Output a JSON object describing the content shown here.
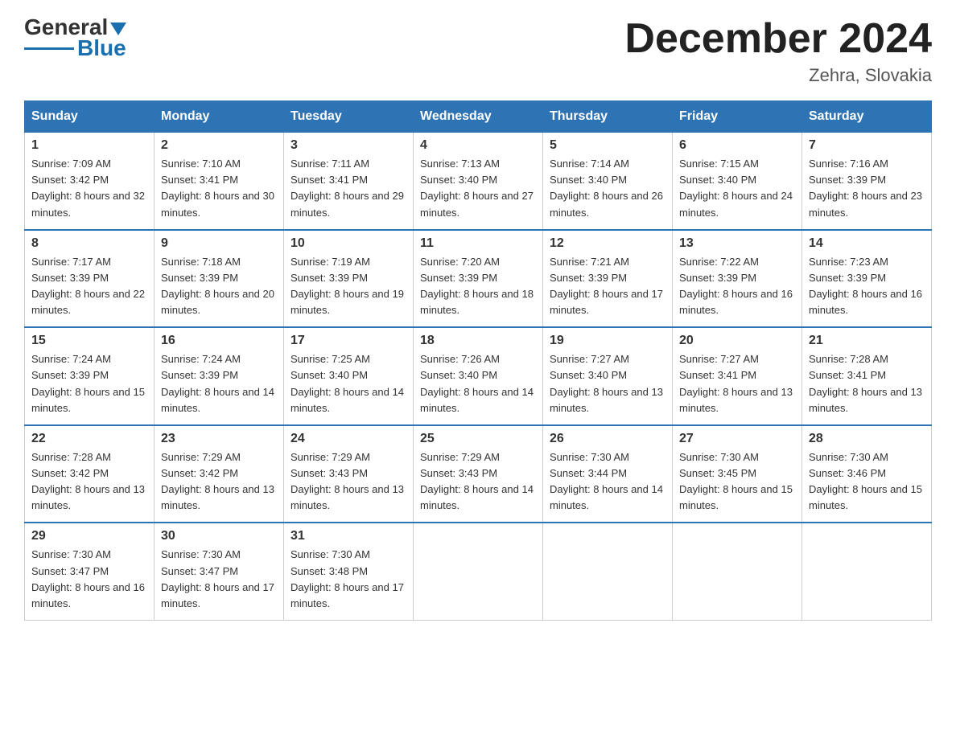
{
  "header": {
    "logo": {
      "general": "General",
      "blue": "Blue"
    },
    "title": "December 2024",
    "location": "Zehra, Slovakia"
  },
  "weekdays": [
    "Sunday",
    "Monday",
    "Tuesday",
    "Wednesday",
    "Thursday",
    "Friday",
    "Saturday"
  ],
  "weeks": [
    [
      {
        "day": "1",
        "sunrise": "7:09 AM",
        "sunset": "3:42 PM",
        "daylight": "8 hours and 32 minutes."
      },
      {
        "day": "2",
        "sunrise": "7:10 AM",
        "sunset": "3:41 PM",
        "daylight": "8 hours and 30 minutes."
      },
      {
        "day": "3",
        "sunrise": "7:11 AM",
        "sunset": "3:41 PM",
        "daylight": "8 hours and 29 minutes."
      },
      {
        "day": "4",
        "sunrise": "7:13 AM",
        "sunset": "3:40 PM",
        "daylight": "8 hours and 27 minutes."
      },
      {
        "day": "5",
        "sunrise": "7:14 AM",
        "sunset": "3:40 PM",
        "daylight": "8 hours and 26 minutes."
      },
      {
        "day": "6",
        "sunrise": "7:15 AM",
        "sunset": "3:40 PM",
        "daylight": "8 hours and 24 minutes."
      },
      {
        "day": "7",
        "sunrise": "7:16 AM",
        "sunset": "3:39 PM",
        "daylight": "8 hours and 23 minutes."
      }
    ],
    [
      {
        "day": "8",
        "sunrise": "7:17 AM",
        "sunset": "3:39 PM",
        "daylight": "8 hours and 22 minutes."
      },
      {
        "day": "9",
        "sunrise": "7:18 AM",
        "sunset": "3:39 PM",
        "daylight": "8 hours and 20 minutes."
      },
      {
        "day": "10",
        "sunrise": "7:19 AM",
        "sunset": "3:39 PM",
        "daylight": "8 hours and 19 minutes."
      },
      {
        "day": "11",
        "sunrise": "7:20 AM",
        "sunset": "3:39 PM",
        "daylight": "8 hours and 18 minutes."
      },
      {
        "day": "12",
        "sunrise": "7:21 AM",
        "sunset": "3:39 PM",
        "daylight": "8 hours and 17 minutes."
      },
      {
        "day": "13",
        "sunrise": "7:22 AM",
        "sunset": "3:39 PM",
        "daylight": "8 hours and 16 minutes."
      },
      {
        "day": "14",
        "sunrise": "7:23 AM",
        "sunset": "3:39 PM",
        "daylight": "8 hours and 16 minutes."
      }
    ],
    [
      {
        "day": "15",
        "sunrise": "7:24 AM",
        "sunset": "3:39 PM",
        "daylight": "8 hours and 15 minutes."
      },
      {
        "day": "16",
        "sunrise": "7:24 AM",
        "sunset": "3:39 PM",
        "daylight": "8 hours and 14 minutes."
      },
      {
        "day": "17",
        "sunrise": "7:25 AM",
        "sunset": "3:40 PM",
        "daylight": "8 hours and 14 minutes."
      },
      {
        "day": "18",
        "sunrise": "7:26 AM",
        "sunset": "3:40 PM",
        "daylight": "8 hours and 14 minutes."
      },
      {
        "day": "19",
        "sunrise": "7:27 AM",
        "sunset": "3:40 PM",
        "daylight": "8 hours and 13 minutes."
      },
      {
        "day": "20",
        "sunrise": "7:27 AM",
        "sunset": "3:41 PM",
        "daylight": "8 hours and 13 minutes."
      },
      {
        "day": "21",
        "sunrise": "7:28 AM",
        "sunset": "3:41 PM",
        "daylight": "8 hours and 13 minutes."
      }
    ],
    [
      {
        "day": "22",
        "sunrise": "7:28 AM",
        "sunset": "3:42 PM",
        "daylight": "8 hours and 13 minutes."
      },
      {
        "day": "23",
        "sunrise": "7:29 AM",
        "sunset": "3:42 PM",
        "daylight": "8 hours and 13 minutes."
      },
      {
        "day": "24",
        "sunrise": "7:29 AM",
        "sunset": "3:43 PM",
        "daylight": "8 hours and 13 minutes."
      },
      {
        "day": "25",
        "sunrise": "7:29 AM",
        "sunset": "3:43 PM",
        "daylight": "8 hours and 14 minutes."
      },
      {
        "day": "26",
        "sunrise": "7:30 AM",
        "sunset": "3:44 PM",
        "daylight": "8 hours and 14 minutes."
      },
      {
        "day": "27",
        "sunrise": "7:30 AM",
        "sunset": "3:45 PM",
        "daylight": "8 hours and 15 minutes."
      },
      {
        "day": "28",
        "sunrise": "7:30 AM",
        "sunset": "3:46 PM",
        "daylight": "8 hours and 15 minutes."
      }
    ],
    [
      {
        "day": "29",
        "sunrise": "7:30 AM",
        "sunset": "3:47 PM",
        "daylight": "8 hours and 16 minutes."
      },
      {
        "day": "30",
        "sunrise": "7:30 AM",
        "sunset": "3:47 PM",
        "daylight": "8 hours and 17 minutes."
      },
      {
        "day": "31",
        "sunrise": "7:30 AM",
        "sunset": "3:48 PM",
        "daylight": "8 hours and 17 minutes."
      },
      null,
      null,
      null,
      null
    ]
  ]
}
